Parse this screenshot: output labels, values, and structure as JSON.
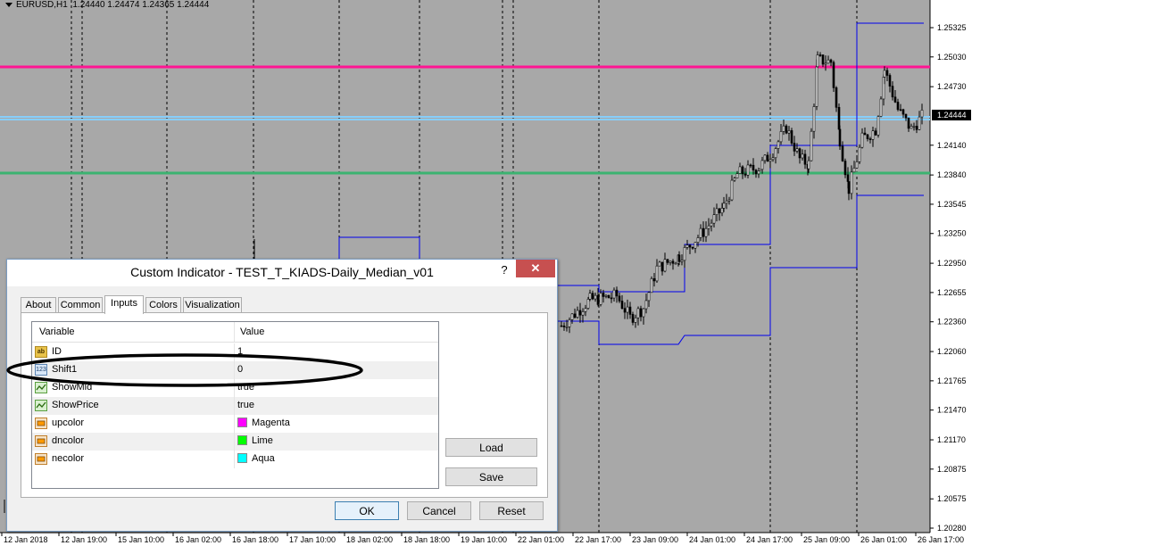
{
  "chart": {
    "title": "EURUSD,H1",
    "quote": "1.24440 1.24474 1.24365 1.24444",
    "current_price_label": "1.24444",
    "price_labels": [
      "1.25325",
      "1.25030",
      "1.24730",
      "1.24140",
      "1.23840",
      "1.23545",
      "1.23250",
      "1.22950",
      "1.22655",
      "1.22360",
      "1.22060",
      "1.21765",
      "1.21470",
      "1.21170",
      "1.20875",
      "1.20575",
      "1.20280"
    ],
    "time_labels": [
      "12 Jan 2018",
      "12 Jan 19:00",
      "15 Jan 10:00",
      "16 Jan 02:00",
      "16 Jan 18:00",
      "17 Jan 10:00",
      "18 Jan 02:00",
      "18 Jan 18:00",
      "19 Jan 10:00",
      "22 Jan 01:00",
      "22 Jan 17:00",
      "23 Jan 09:00",
      "24 Jan 01:00",
      "24 Jan 17:00",
      "25 Jan 09:00",
      "26 Jan 01:00",
      "26 Jan 17:00"
    ],
    "colors": {
      "background": "#a8a8a8",
      "magenta_line": "#ff1493",
      "aqua_line": "#87cefa",
      "green_line": "#3cb371",
      "median_line": "#0000ee",
      "candle": "#000000"
    }
  },
  "dialog": {
    "title": "Custom Indicator - TEST_T_KIADS-Daily_Median_v01",
    "help_label": "?",
    "close_label": "✕",
    "tabs": [
      "About",
      "Common",
      "Inputs",
      "Colors",
      "Visualization"
    ],
    "active_tab": "Inputs",
    "columns": {
      "variable": "Variable",
      "value": "Value"
    },
    "rows": [
      {
        "icon": "string-icon",
        "icon_text": "ab",
        "name": "ID",
        "value": "1"
      },
      {
        "icon": "integer-icon",
        "icon_text": "123",
        "name": "Shift1",
        "value": "0"
      },
      {
        "icon": "bool-icon",
        "icon_text": "",
        "name": "ShowMid",
        "value": "true"
      },
      {
        "icon": "bool-icon",
        "icon_text": "",
        "name": "ShowPrice",
        "value": "true"
      },
      {
        "icon": "color-icon",
        "icon_text": "",
        "name": "upcolor",
        "value": "Magenta",
        "swatch": "#ff00ff"
      },
      {
        "icon": "color-icon",
        "icon_text": "",
        "name": "dncolor",
        "value": "Lime",
        "swatch": "#00ff00"
      },
      {
        "icon": "color-icon",
        "icon_text": "",
        "name": "necolor",
        "value": "Aqua",
        "swatch": "#00ffff"
      }
    ],
    "buttons": {
      "load": "Load",
      "save": "Save",
      "ok": "OK",
      "cancel": "Cancel",
      "reset": "Reset"
    }
  }
}
